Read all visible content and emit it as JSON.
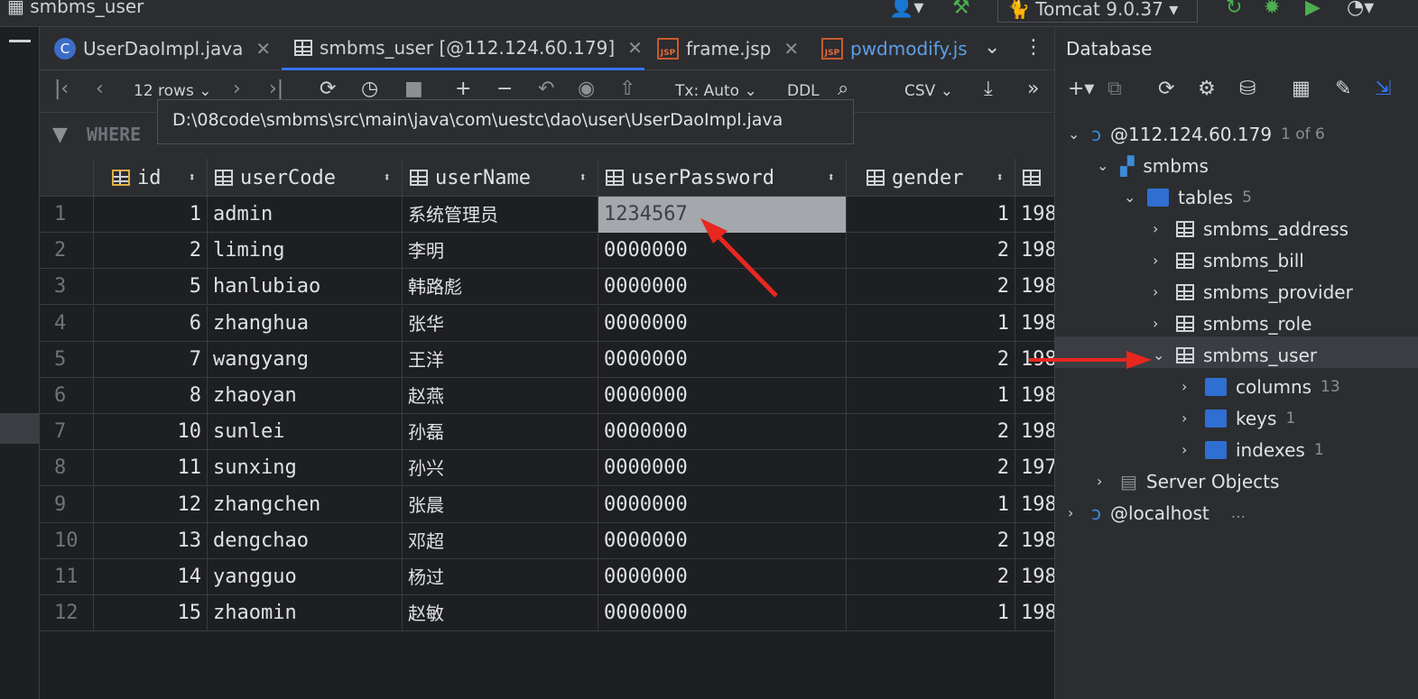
{
  "window": {
    "title": "smbms_user",
    "run_config": "Tomcat 9.0.37"
  },
  "tabs": [
    {
      "label": "UserDaoImpl.java",
      "icon": "java-class-icon",
      "active": false
    },
    {
      "label": "smbms_user [@112.124.60.179]",
      "icon": "table-icon",
      "active": true
    },
    {
      "label": "frame.jsp",
      "icon": "jsp-icon",
      "active": false
    },
    {
      "label": "pwdmodify.js",
      "icon": "jsp-icon",
      "active": false
    }
  ],
  "toolbar": {
    "rows": "12 rows",
    "tx": "Tx: Auto",
    "ddl": "DDL",
    "export": "CSV"
  },
  "filter": {
    "where": "WHERE"
  },
  "tooltip": "D:\\08code\\smbms\\src\\main\\java\\com\\uestc\\dao\\user\\UserDaoImpl.java",
  "grid": {
    "columns": [
      "id",
      "userCode",
      "userName",
      "userPassword",
      "gender"
    ],
    "rows": [
      {
        "n": "1",
        "id": "1",
        "code": "admin",
        "name": "系统管理员",
        "pwd": "1234567",
        "gender": "1",
        "next": "198"
      },
      {
        "n": "2",
        "id": "2",
        "code": "liming",
        "name": "李明",
        "pwd": "0000000",
        "gender": "2",
        "next": "198"
      },
      {
        "n": "3",
        "id": "5",
        "code": "hanlubiao",
        "name": "韩路彪",
        "pwd": "0000000",
        "gender": "2",
        "next": "198"
      },
      {
        "n": "4",
        "id": "6",
        "code": "zhanghua",
        "name": "张华",
        "pwd": "0000000",
        "gender": "1",
        "next": "198"
      },
      {
        "n": "5",
        "id": "7",
        "code": "wangyang",
        "name": "王洋",
        "pwd": "0000000",
        "gender": "2",
        "next": "198"
      },
      {
        "n": "6",
        "id": "8",
        "code": "zhaoyan",
        "name": "赵燕",
        "pwd": "0000000",
        "gender": "1",
        "next": "198"
      },
      {
        "n": "7",
        "id": "10",
        "code": "sunlei",
        "name": "孙磊",
        "pwd": "0000000",
        "gender": "2",
        "next": "198"
      },
      {
        "n": "8",
        "id": "11",
        "code": "sunxing",
        "name": "孙兴",
        "pwd": "0000000",
        "gender": "2",
        "next": "197"
      },
      {
        "n": "9",
        "id": "12",
        "code": "zhangchen",
        "name": "张晨",
        "pwd": "0000000",
        "gender": "1",
        "next": "198"
      },
      {
        "n": "10",
        "id": "13",
        "code": "dengchao",
        "name": "邓超",
        "pwd": "0000000",
        "gender": "2",
        "next": "198"
      },
      {
        "n": "11",
        "id": "14",
        "code": "yangguo",
        "name": "杨过",
        "pwd": "0000000",
        "gender": "2",
        "next": "198"
      },
      {
        "n": "12",
        "id": "15",
        "code": "zhaomin",
        "name": "赵敏",
        "pwd": "0000000",
        "gender": "1",
        "next": "198"
      }
    ]
  },
  "database": {
    "title": "Database",
    "tree": {
      "host": "@112.124.60.179",
      "host_count": "1 of 6",
      "schema": "smbms",
      "tables_label": "tables",
      "tables_count": "5",
      "tables": [
        "smbms_address",
        "smbms_bill",
        "smbms_provider",
        "smbms_role",
        "smbms_user"
      ],
      "columns_label": "columns",
      "columns_count": "13",
      "keys_label": "keys",
      "keys_count": "1",
      "indexes_label": "indexes",
      "indexes_count": "1",
      "server_objects": "Server Objects",
      "localhost": "@localhost",
      "localhost_more": "..."
    }
  },
  "colors": {
    "accent": "#3574f0",
    "folder": "#2f6fd1",
    "annotation_arrow": "#e8271f"
  }
}
